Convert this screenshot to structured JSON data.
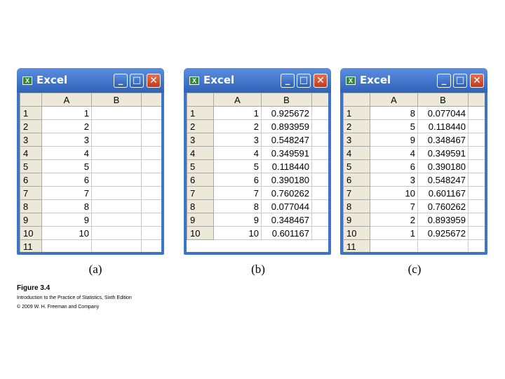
{
  "windows": [
    {
      "title": "Excel",
      "caption": "(a)",
      "columns": [
        "",
        "A",
        "B"
      ],
      "rows": [
        {
          "n": "1",
          "a": "1",
          "b": ""
        },
        {
          "n": "2",
          "a": "2",
          "b": ""
        },
        {
          "n": "3",
          "a": "3",
          "b": ""
        },
        {
          "n": "4",
          "a": "4",
          "b": ""
        },
        {
          "n": "5",
          "a": "5",
          "b": ""
        },
        {
          "n": "6",
          "a": "6",
          "b": ""
        },
        {
          "n": "7",
          "a": "7",
          "b": ""
        },
        {
          "n": "8",
          "a": "8",
          "b": ""
        },
        {
          "n": "9",
          "a": "9",
          "b": ""
        },
        {
          "n": "10",
          "a": "10",
          "b": ""
        },
        {
          "n": "11",
          "a": "",
          "b": ""
        }
      ]
    },
    {
      "title": "Excel",
      "caption": "(b)",
      "columns": [
        "",
        "A",
        "B"
      ],
      "rows": [
        {
          "n": "1",
          "a": "1",
          "b": "0.925672"
        },
        {
          "n": "2",
          "a": "2",
          "b": "0.893959"
        },
        {
          "n": "3",
          "a": "3",
          "b": "0.548247"
        },
        {
          "n": "4",
          "a": "4",
          "b": "0.349591"
        },
        {
          "n": "5",
          "a": "5",
          "b": "0.118440"
        },
        {
          "n": "6",
          "a": "6",
          "b": "0.390180"
        },
        {
          "n": "7",
          "a": "7",
          "b": "0.760262"
        },
        {
          "n": "8",
          "a": "8",
          "b": "0.077044"
        },
        {
          "n": "9",
          "a": "9",
          "b": "0.348467"
        },
        {
          "n": "10",
          "a": "10",
          "b": "0.601167"
        }
      ]
    },
    {
      "title": "Excel",
      "caption": "(c)",
      "columns": [
        "",
        "A",
        "B"
      ],
      "rows": [
        {
          "n": "1",
          "a": "8",
          "b": "0.077044"
        },
        {
          "n": "2",
          "a": "5",
          "b": "0.118440"
        },
        {
          "n": "3",
          "a": "9",
          "b": "0.348467"
        },
        {
          "n": "4",
          "a": "4",
          "b": "0.349591"
        },
        {
          "n": "5",
          "a": "6",
          "b": "0.390180"
        },
        {
          "n": "6",
          "a": "3",
          "b": "0.548247"
        },
        {
          "n": "7",
          "a": "10",
          "b": "0.601167"
        },
        {
          "n": "8",
          "a": "7",
          "b": "0.760262"
        },
        {
          "n": "9",
          "a": "2",
          "b": "0.893959"
        },
        {
          "n": "10",
          "a": "1",
          "b": "0.925672"
        },
        {
          "n": "11",
          "a": "",
          "b": ""
        }
      ]
    }
  ],
  "buttons": {
    "minimize": "_",
    "maximize": "□",
    "close": "✕"
  },
  "figure": {
    "title": "Figure 3.4",
    "line1": "Introduction to the Practice of Statistics, Sixth Edition",
    "line2": "© 2009 W. H. Freeman and Company"
  },
  "colors": {
    "title_bar": "#3d74c8",
    "close_button": "#d24a2a",
    "header_bg": "#ece9d8"
  }
}
